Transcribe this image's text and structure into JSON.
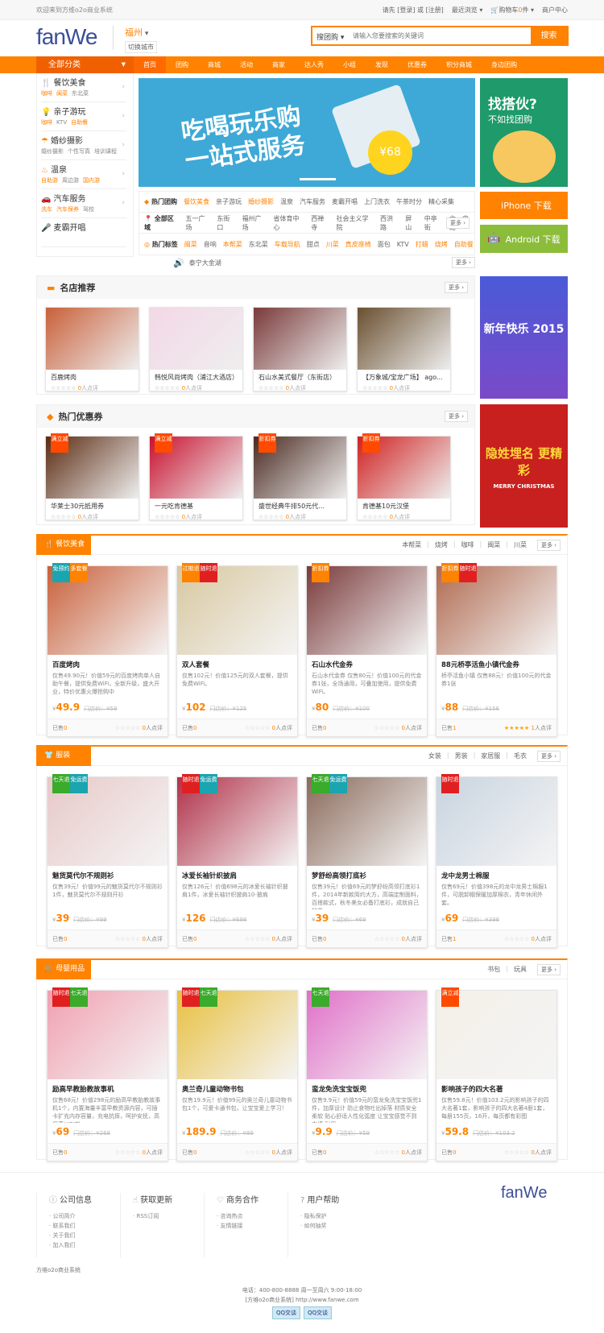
{
  "topbar": {
    "welcome": "欢迎来到方维o2o商业系统",
    "login_prompt": "请先",
    "login": "[登录]",
    "or": "或",
    "register": "[注册]",
    "recent": "最近浏览 ▾",
    "cart": "购物车",
    "cart_count": "0",
    "cart_unit": "件 ▾",
    "merchant": "商户中心"
  },
  "header": {
    "logo": "fanWe",
    "city": "福州",
    "switch_city": "切换城市",
    "search_type": "搜团购",
    "search_placeholder": "请输入您要搜索的关键词",
    "search_button": "搜索"
  },
  "nav": {
    "all": "全部分类",
    "items": [
      "首页",
      "团购",
      "商城",
      "活动",
      "商家",
      "达人秀",
      "小组",
      "发现",
      "优惠券",
      "积分商城",
      "身边团购"
    ]
  },
  "sidebar": [
    {
      "title": "餐饮美食",
      "icon": "fork-knife-icon",
      "subs": [
        {
          "t": "咖啡",
          "hot": true
        },
        {
          "t": "闽菜",
          "hot": true
        },
        {
          "t": "东北菜",
          "hot": false
        }
      ]
    },
    {
      "title": "亲子游玩",
      "icon": "lightbulb-icon",
      "subs": [
        {
          "t": "咖啡",
          "hot": true
        },
        {
          "t": "KTV",
          "hot": false
        },
        {
          "t": "自助餐",
          "hot": true
        }
      ]
    },
    {
      "title": "婚纱摄影",
      "icon": "umbrella-icon",
      "subs": [
        {
          "t": "婚纱摄影",
          "hot": false
        },
        {
          "t": "个性写真",
          "hot": false
        },
        {
          "t": "培训课程",
          "hot": false
        }
      ]
    },
    {
      "title": "温泉",
      "icon": "hotspring-icon",
      "subs": [
        {
          "t": "自助游",
          "hot": true
        },
        {
          "t": "周边游",
          "hot": false
        },
        {
          "t": "国内游",
          "hot": true
        }
      ]
    },
    {
      "title": "汽车服务",
      "icon": "car-icon",
      "subs": [
        {
          "t": "洗车",
          "hot": true
        },
        {
          "t": "汽车保养",
          "hot": true
        },
        {
          "t": "驾校",
          "hot": false
        }
      ]
    },
    {
      "title": "麦霸开唱",
      "icon": "mic-icon",
      "subs": []
    }
  ],
  "banner": {
    "line1": "吃喝玩乐购",
    "line2": "一站式服务",
    "coupon": "¥68"
  },
  "tags": {
    "hot_deals": {
      "label": "热门团购",
      "items": [
        {
          "t": "餐饮美食",
          "hot": true
        },
        {
          "t": "亲子游玩",
          "hot": false
        },
        {
          "t": "婚纱摄影",
          "hot": true
        },
        {
          "t": "温泉",
          "hot": false
        },
        {
          "t": "汽车服务",
          "hot": false
        },
        {
          "t": "麦霸开唱",
          "hot": false
        },
        {
          "t": "上门洗衣",
          "hot": false
        },
        {
          "t": "午茶时分",
          "hot": false
        },
        {
          "t": "精心采集",
          "hot": false
        }
      ]
    },
    "areas": {
      "label": "全部区域",
      "items": [
        {
          "t": "五一广场"
        },
        {
          "t": "东街口"
        },
        {
          "t": "福州广场"
        },
        {
          "t": "省体育中心"
        },
        {
          "t": "西禅寺"
        },
        {
          "t": "社会主义学院"
        },
        {
          "t": "西洪路"
        },
        {
          "t": "屏山"
        },
        {
          "t": "中亭街"
        },
        {
          "t": "六一中路"
        }
      ],
      "more": "更多 ›"
    },
    "hot_tags": {
      "label": "热门标签",
      "items": [
        {
          "t": "闽菜",
          "hot": true
        },
        {
          "t": "音响",
          "hot": false
        },
        {
          "t": "本帮菜",
          "hot": true
        },
        {
          "t": "东北菜",
          "hot": false
        },
        {
          "t": "车载导航",
          "hot": true
        },
        {
          "t": "甜点",
          "hot": false
        },
        {
          "t": "川菜",
          "hot": true
        },
        {
          "t": "真皮座椅",
          "hot": true
        },
        {
          "t": "面包",
          "hot": false
        },
        {
          "t": "KTV",
          "hot": false
        },
        {
          "t": "打蜡",
          "hot": true
        },
        {
          "t": "烧烤",
          "hot": true
        },
        {
          "t": "自助餐",
          "hot": true
        }
      ]
    }
  },
  "notice": {
    "text": "泰宁大金湖",
    "more": "更多 ›"
  },
  "right": {
    "ad1_title": "找搭伙?",
    "ad1_sub": "不如找团购",
    "iphone": "iPhone 下载",
    "android": "Android 下载",
    "ad2_text": "新年快乐 2015",
    "ad3_text": "隐姓埋名 更精彩",
    "ad3_sub": "MERRY CHRISTMAS"
  },
  "shops": {
    "title": "名店推荐",
    "more": "更多 ›",
    "items": [
      {
        "name": "百鹿烤肉",
        "rating": "0",
        "reviews": "人点评",
        "color": "#c9603a"
      },
      {
        "name": "韩悦风尚烤肉（浦江大酒店）",
        "rating": "0",
        "reviews": "人点评",
        "color": "#f3d8e6"
      },
      {
        "name": "石山水美式餐厅（东街店）",
        "rating": "0",
        "reviews": "人点评",
        "color": "#7a3a3a"
      },
      {
        "name": "【万象城/宝龙广场】 ago...",
        "rating": "0",
        "reviews": "人点评",
        "color": "#6a5030"
      }
    ]
  },
  "coupons": {
    "title": "热门优惠券",
    "more": "更多 ›",
    "items": [
      {
        "name": "华莱士30元抵用券",
        "badge": "满立减",
        "rating": "0",
        "reviews": "人点评",
        "color": "#5a2a10"
      },
      {
        "name": "一元吃肯德基",
        "badge": "满立减",
        "rating": "0",
        "reviews": "人点评",
        "color": "#c8102e"
      },
      {
        "name": "盛世经典牛排50元代...",
        "badge": "折扣券",
        "rating": "0",
        "reviews": "人点评",
        "color": "#4a2a20"
      },
      {
        "name": "肯德基10元汉堡",
        "badge": "折扣券",
        "rating": "0",
        "reviews": "人点评",
        "color": "#d02020"
      }
    ]
  },
  "floors": [
    {
      "title": "餐饮美食",
      "icon": "fork-knife-icon",
      "links": [
        "本帮菜",
        "烧烤",
        "咖啡",
        "闽菜",
        "川菜"
      ],
      "more": "更多 ›",
      "items": [
        {
          "name": "百度烤肉",
          "desc": "仅售49.90元！价值59元的百度烤肉单人自助午餐，提供免费WiFi，全新升级，盛大开业，特价优惠火爆抢购中",
          "price": "49.9",
          "orig": "门店价：¥59",
          "sold_label": "已售",
          "sold": "0",
          "rating": "0",
          "reviews": "人点评",
          "stars": 0,
          "badges": [
            {
              "t": "免预约",
              "c": "#1aa5b0"
            },
            {
              "t": "多套餐",
              "c": "#ff8200"
            }
          ],
          "color": "#c9603a"
        },
        {
          "name": "双人套餐",
          "desc": "仅售102元！价值125元的双人套餐，提供免费WiFi。",
          "price": "102",
          "orig": "门店价：¥125",
          "sold_label": "已售",
          "sold": "0",
          "rating": "0",
          "reviews": "人点评",
          "stars": 0,
          "badges": [
            {
              "t": "过期退",
              "c": "#ff8200"
            },
            {
              "t": "随时退",
              "c": "#e02020"
            }
          ],
          "color": "#d8c8a0"
        },
        {
          "name": "石山水代金券",
          "desc": "石山水代金券 仅售80元！价值100元的代金券1张，全场通用，可叠加使用，提供免费WiFi。",
          "price": "80",
          "orig": "门店价：¥100",
          "sold_label": "已售",
          "sold": "0",
          "rating": "0",
          "reviews": "人点评",
          "stars": 0,
          "badges": [
            {
              "t": "折扣券",
              "c": "#ff8200"
            }
          ],
          "color": "#7a3a3a"
        },
        {
          "name": "88元桥亭活鱼小镇代金券",
          "desc": "桥亭活鱼小镇 仅售88元！价值100元的代金券1张",
          "price": "88",
          "orig": "门店价：¥156",
          "sold_label": "已售",
          "sold": "1",
          "rating": "1",
          "reviews": "人点评",
          "stars": 5,
          "badges": [
            {
              "t": "折扣券",
              "c": "#ff8200"
            },
            {
              "t": "随时退",
              "c": "#e02020"
            }
          ],
          "color": "#b06a50"
        }
      ]
    },
    {
      "title": "服装",
      "icon": "shirt-icon",
      "links": [
        "女装",
        "男装",
        "家居服",
        "毛衣"
      ],
      "more": "更多 ›",
      "items": [
        {
          "name": "魅货莫代尔不规则衫",
          "desc": "仅售39元！价值99元的魅货莫代尔不规则衫1件，魅货莫代尔不规则开衫",
          "price": "39",
          "orig": "门店价：¥99",
          "sold_label": "已售",
          "sold": "0",
          "rating": "0",
          "reviews": "人点评",
          "stars": 0,
          "badges": [
            {
              "t": "七天退",
              "c": "#3aab2a"
            },
            {
              "t": "免运费",
              "c": "#1aa5b0"
            }
          ],
          "color": "#e8c8c8"
        },
        {
          "name": "冰爱长袖针织披肩",
          "desc": "仅售126元！价值698元的冰爱长袖针织披肩1件，冰爱长袖针织披肩10-披肩",
          "price": "126",
          "orig": "门店价：¥698",
          "sold_label": "已售",
          "sold": "0",
          "rating": "0",
          "reviews": "人点评",
          "stars": 0,
          "badges": [
            {
              "t": "随时退",
              "c": "#e02020"
            },
            {
              "t": "免运费",
              "c": "#1aa5b0"
            }
          ],
          "color": "#b03048"
        },
        {
          "name": "梦舒纷高领打底衫",
          "desc": "仅售39元！价值69元的梦舒纷高领打底衫1件，2014年新款简约大方，高端定制面料，百搭款式，秋冬美女必备打底衫，成就自己的美",
          "price": "39",
          "orig": "门店价：¥69",
          "sold_label": "已售",
          "sold": "0",
          "rating": "0",
          "reviews": "人点评",
          "stars": 0,
          "badges": [
            {
              "t": "七天退",
              "c": "#3aab2a"
            },
            {
              "t": "免运费",
              "c": "#1aa5b0"
            }
          ],
          "color": "#8a6a5a"
        },
        {
          "name": "龙中龙男士棉服",
          "desc": "仅售69元！价值398元的龙中龙男士棉服1件，可脱卸帽保暖加厚棉衣，青年休闲外套。",
          "price": "69",
          "orig": "门店价：¥398",
          "sold_label": "已售",
          "sold": "1",
          "rating": "0",
          "reviews": "人点评",
          "stars": 0,
          "badges": [
            {
              "t": "随时退",
              "c": "#e02020"
            }
          ],
          "color": "#c8d4e0"
        }
      ]
    },
    {
      "title": "母婴用品",
      "icon": "stroller-icon",
      "links": [
        "书包",
        "玩具"
      ],
      "more": "更多 ›",
      "items": [
        {
          "name": "励高早教胎教故事机",
          "desc": "仅售68元！价值298元的励高早教胎教故事机1个，内置海量丰富早教资源内容，可插卡扩充内存容量，充电抗摔，呵护安抚，高保真HIFI喇",
          "price": "69",
          "orig": "门店价：¥268",
          "sold_label": "已售",
          "sold": "0",
          "rating": "0",
          "reviews": "人点评",
          "stars": 0,
          "badges": [
            {
              "t": "随时退",
              "c": "#e02020"
            },
            {
              "t": "七天退",
              "c": "#3aab2a"
            }
          ],
          "color": "#f0a0b0"
        },
        {
          "name": "奥兰奇儿童动物书包",
          "desc": "仅售19.9元！价值99元的奥兰奇儿童动物书包1个，可爱卡通书包，让宝宝爱上学习！",
          "price": "189.9",
          "orig": "门店价：¥99",
          "sold_label": "已售",
          "sold": "0",
          "rating": "0",
          "reviews": "人点评",
          "stars": 0,
          "badges": [
            {
              "t": "随时退",
              "c": "#e02020"
            },
            {
              "t": "七天退",
              "c": "#3aab2a"
            }
          ],
          "color": "#e8c040"
        },
        {
          "name": "蛮龙免洗宝宝饭兜",
          "desc": "仅售9.9元！价值59元的蛮龙免洗宝宝饭兜1件，加厚设计 防止食物吐出掉落 材质安全柔软 贴心舒适人性化弧度 让宝宝感觉不到束缚 耐用",
          "price": "9.9",
          "orig": "门店价：¥59",
          "sold_label": "已售",
          "sold": "0",
          "rating": "0",
          "reviews": "人点评",
          "stars": 0,
          "badges": [
            {
              "t": "七天退",
              "c": "#3aab2a"
            }
          ],
          "color": "#e070c8"
        },
        {
          "name": "影响孩子的四大名著",
          "desc": "仅售59.8元！价值103.2元的影响孩子的四大名著1套，影响孩子的四大名著4册1套，每册155页，16开，每页都有彩图",
          "price": "59.8",
          "orig": "门店价：¥103.2",
          "sold_label": "已售",
          "sold": "0",
          "rating": "0",
          "reviews": "人点评",
          "stars": 0,
          "badges": [
            {
              "t": "满立减",
              "c": "#ff4a00"
            }
          ],
          "color": "#f4f0e8"
        }
      ]
    }
  ],
  "footer": {
    "logo": "fanWe",
    "cols": [
      {
        "title": "公司信息",
        "icon": "info-icon",
        "links": [
          "公司简介",
          "联系我们",
          "关于我们",
          "加入我们"
        ]
      },
      {
        "title": "获取更新",
        "icon": "hand-icon",
        "links": [
          "RSS订阅"
        ]
      },
      {
        "title": "商务合作",
        "icon": "handshake-icon",
        "links": [
          "咨询热点",
          "友情链接"
        ]
      },
      {
        "title": "用户帮助",
        "icon": "help-icon",
        "links": [
          "隐私保护",
          "如何抽奖"
        ]
      }
    ],
    "copyright": "方维o2o商业系统",
    "phone": "电话：400-800-8888 周一至周六 9:00-18:00",
    "site": "[方维o2o商业系统] http://www.fanwe.com",
    "qq": [
      "QQ交谈",
      "QQ交谈"
    ]
  },
  "colors": {
    "brand": "#ff8200",
    "nav_dark": "#f06000",
    "logo": "#3a4f9a",
    "android": "#8cbd3a"
  }
}
